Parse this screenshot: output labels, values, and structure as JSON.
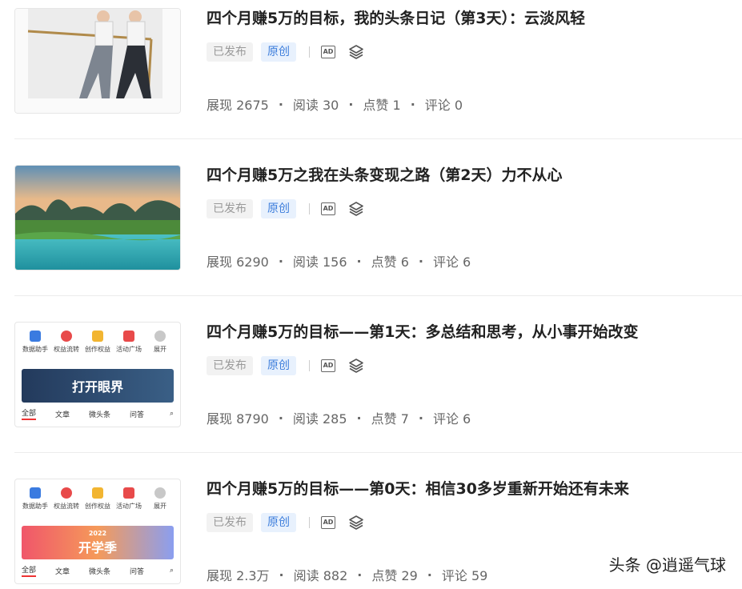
{
  "articles": [
    {
      "title": "四个月赚5万的目标，我的头条日记（第3天）：云淡风轻",
      "status": "已发布",
      "original": "原创",
      "ad": "AD",
      "stats": {
        "views": "展现 2675",
        "reads": "阅读 30",
        "likes": "点赞 1",
        "comments": "评论 0"
      }
    },
    {
      "title": "四个月赚5万之我在头条变现之路（第2天）力不从心",
      "status": "已发布",
      "original": "原创",
      "ad": "AD",
      "stats": {
        "views": "展现 6290",
        "reads": "阅读 156",
        "likes": "点赞 6",
        "comments": "评论 6"
      }
    },
    {
      "title": "四个月赚5万的目标——第1天：多总结和思考，从小事开始改变",
      "status": "已发布",
      "original": "原创",
      "ad": "AD",
      "stats": {
        "views": "展现 8790",
        "reads": "阅读 285",
        "likes": "点赞 7",
        "comments": "评论 6"
      },
      "thumb": {
        "apps": [
          "数据助手",
          "权益流转",
          "创作权益",
          "活动广场",
          "展开"
        ],
        "banner": "打开眼界",
        "tabs": [
          "全部",
          "文章",
          "微头条",
          "问答"
        ]
      }
    },
    {
      "title": "四个月赚5万的目标——第0天：相信30多岁重新开始还有未来",
      "status": "已发布",
      "original": "原创",
      "ad": "AD",
      "stats": {
        "views": "展现 2.3万",
        "reads": "阅读 882",
        "likes": "点赞 29",
        "comments": "评论 59"
      },
      "thumb": {
        "apps": [
          "数据助手",
          "权益流转",
          "创作权益",
          "活动广场",
          "展开"
        ],
        "banner": "开学季",
        "banner_year": "2022",
        "tabs": [
          "全部",
          "文章",
          "微头条",
          "问答"
        ]
      }
    }
  ],
  "watermark": "头条 @逍遥气球",
  "colors": {
    "accent": "#3c7ddb",
    "tag_bg": "#e8f1fd",
    "active_tab": "#e33333"
  }
}
